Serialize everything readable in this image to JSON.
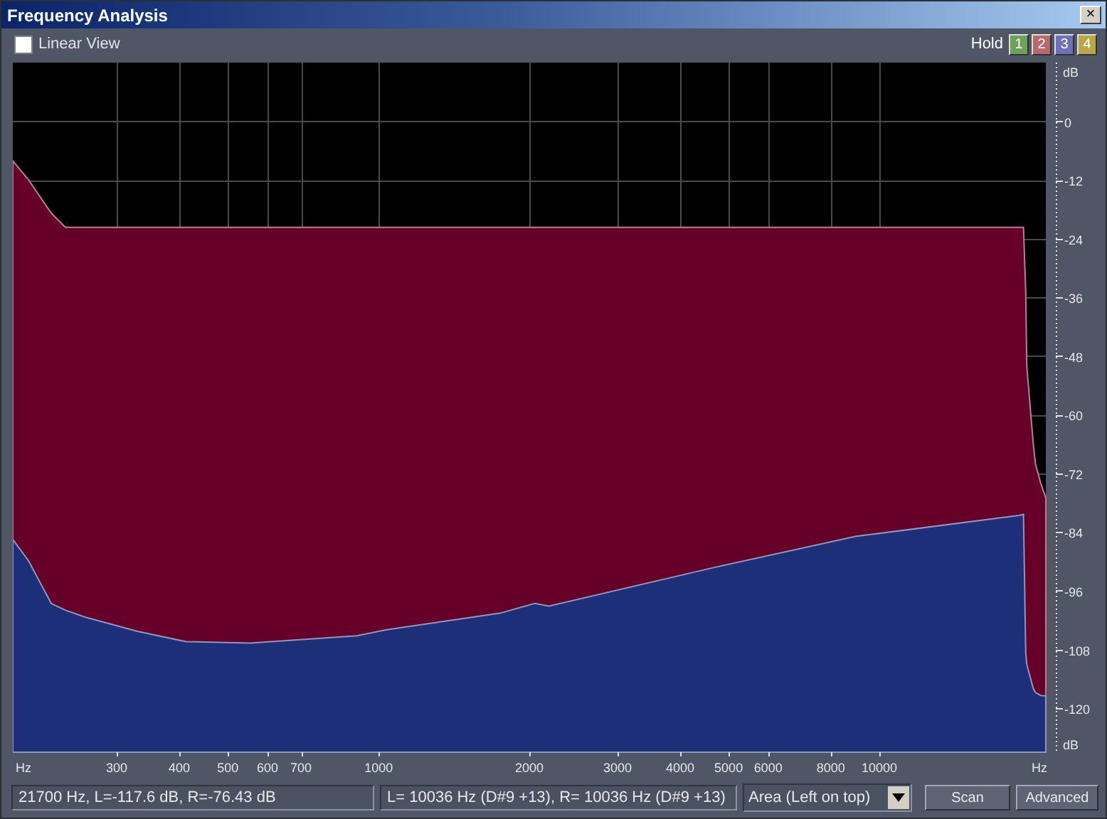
{
  "window": {
    "title": "Frequency Analysis",
    "close": "×"
  },
  "toolbar": {
    "linear_view": {
      "label": "Linear View",
      "checked": false
    },
    "hold_label": "Hold",
    "hold_buttons": [
      {
        "label": "1",
        "color": "#6fa15a"
      },
      {
        "label": "2",
        "color": "#b86a6a"
      },
      {
        "label": "3",
        "color": "#7070b8"
      },
      {
        "label": "4",
        "color": "#b8a848"
      }
    ]
  },
  "spectrum": {
    "y_unit_top": "dB",
    "y_unit_bottom": "dB",
    "x_unit_left": "Hz",
    "x_unit_right": "Hz",
    "y_labels": [
      "0",
      "-12",
      "-24",
      "-36",
      "-48",
      "-60",
      "-72",
      "-84",
      "-96",
      "-108",
      "-120"
    ],
    "x_labels": [
      "300",
      "400",
      "500",
      "600",
      "700",
      "1000",
      "2000",
      "3000",
      "4000",
      "5000",
      "6000",
      "8000",
      "10000"
    ]
  },
  "status_bar": {
    "cursor": "21700 Hz, L=-117.6 dB, R=-76.43 dB",
    "peak": "L=  10036 Hz (D#9 +13), R=  10036 Hz (D#9 +13)",
    "mode": "Area (Left on top)",
    "scan": "Scan",
    "advanced": "Advanced"
  }
}
